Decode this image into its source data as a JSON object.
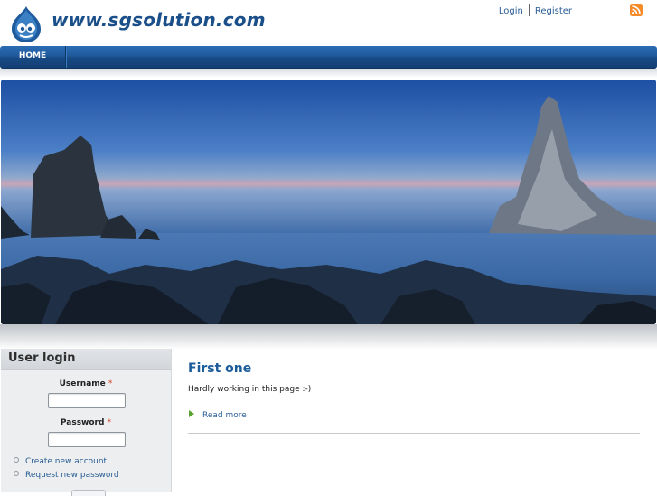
{
  "site": {
    "name": "www.sgsolution.com",
    "logo_icon": "drupal-drop-icon"
  },
  "header": {
    "login_label": "Login",
    "register_label": "Register",
    "rss_icon": "rss-feed-icon"
  },
  "nav": {
    "items": [
      {
        "label": "HOME"
      }
    ]
  },
  "banner": {
    "description_icon": "seascape-banner-image"
  },
  "sidebar": {
    "block_title": "User login",
    "username_label": "Username",
    "password_label": "Password",
    "required_marker": "*",
    "username_value": "",
    "password_value": "",
    "links": [
      {
        "label": "Create new account"
      },
      {
        "label": "Request new password"
      }
    ]
  },
  "content": {
    "node_title": "First one",
    "node_body": "Hardly working in this page :-)",
    "read_more_label": "Read more"
  },
  "colors": {
    "brand_blue": "#1b4f8a",
    "nav_blue": "#1f5a9c",
    "link_blue": "#2a5d96",
    "required_red": "#d43a1f",
    "read_more_arrow": "#5ba32f"
  }
}
